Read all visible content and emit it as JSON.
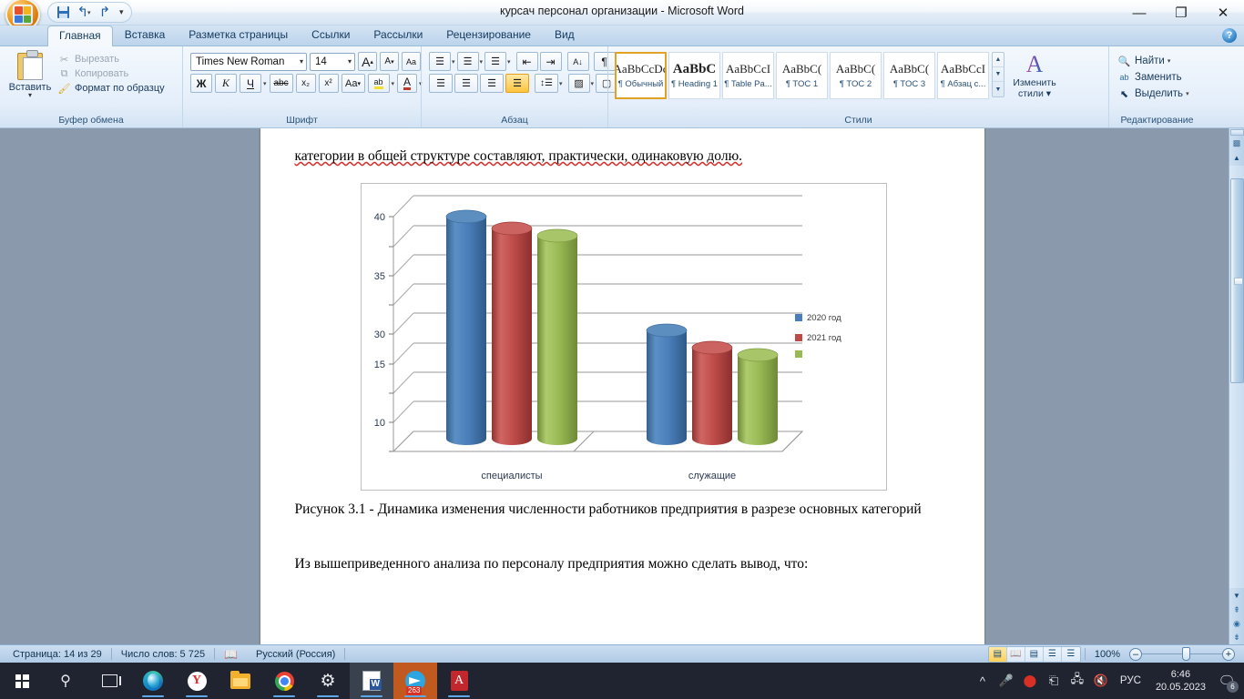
{
  "window": {
    "title": "курсач персонал организации - Microsoft Word",
    "minimize": "—",
    "maximize": "❐",
    "close": "✕",
    "help": "?"
  },
  "quick_access": {
    "save": "save-icon",
    "undo": "↰",
    "undo_caret": "▾",
    "redo": "↱",
    "customize": "▾"
  },
  "ribbon": {
    "tabs": [
      {
        "label": "Главная",
        "active": true
      },
      {
        "label": "Вставка",
        "active": false
      },
      {
        "label": "Разметка страницы",
        "active": false
      },
      {
        "label": "Ссылки",
        "active": false
      },
      {
        "label": "Рассылки",
        "active": false
      },
      {
        "label": "Рецензирование",
        "active": false
      },
      {
        "label": "Вид",
        "active": false
      }
    ],
    "clipboard": {
      "group_label": "Буфер обмена",
      "paste_label": "Вставить",
      "paste_caret": "▾",
      "cut_label": "Вырезать",
      "copy_label": "Копировать",
      "format_painter_label": "Формат по образцу",
      "dialog_launcher": "◹"
    },
    "font": {
      "group_label": "Шрифт",
      "font_name": "Times New Roman",
      "font_size": "14",
      "grow_font": "A",
      "shrink_font": "A",
      "clear_format": "Aa",
      "bold": "Ж",
      "italic": "К",
      "underline": "Ч",
      "underline_caret": "▾",
      "strikethrough": "abc",
      "subscript": "x₂",
      "superscript": "x²",
      "change_case": "Aa",
      "change_case_caret": "▾",
      "highlight": "ab",
      "highlight_caret": "▾",
      "font_color": "A",
      "font_color_caret": "▾",
      "dialog_launcher": "◹"
    },
    "paragraph": {
      "group_label": "Абзац",
      "bullets": "☰",
      "numbering": "☰",
      "multilevel": "☰",
      "decrease_indent": "⇤",
      "increase_indent": "⇥",
      "sort": "A↓",
      "show_marks": "¶",
      "align_left": "☰",
      "align_center": "☰",
      "align_right": "☰",
      "align_justify": "☰",
      "line_spacing": "↕",
      "shading": "▨",
      "borders": "▢",
      "dialog_launcher": "◹"
    },
    "styles": {
      "group_label": "Стили",
      "items": [
        {
          "preview": "AaBbCcDc",
          "name": "¶ Обычный",
          "selected": true,
          "bold": false
        },
        {
          "preview": "AaBbC",
          "name": "¶ Heading 1",
          "selected": false,
          "bold": true
        },
        {
          "preview": "AaBbCcI",
          "name": "¶ Table Pa...",
          "selected": false,
          "bold": false
        },
        {
          "preview": "AaBbC(",
          "name": "¶ TOC 1",
          "selected": false,
          "bold": false
        },
        {
          "preview": "AaBbC(",
          "name": "¶ TOC 2",
          "selected": false,
          "bold": false
        },
        {
          "preview": "AaBbC(",
          "name": "¶ TOC 3",
          "selected": false,
          "bold": false
        },
        {
          "preview": "AaBbCcI",
          "name": "¶ Абзац с...",
          "selected": false,
          "bold": false
        }
      ],
      "scroll_up": "▲",
      "scroll_down": "▼",
      "more": "▼",
      "change_styles_label_line1": "Изменить",
      "change_styles_label_line2": "стили ▾",
      "dialog_launcher": "◹"
    },
    "editing": {
      "group_label": "Редактирование",
      "find": "Найти",
      "find_caret": "▾",
      "replace": "Заменить",
      "select": "Выделить",
      "select_caret": "▾"
    }
  },
  "document": {
    "paragraph_top": "категории в общей структуре составляют, практически, одинаковую долю.",
    "caption": "Рисунок 3.1 - Динамика изменения численности работников предприятия в разрезе основных категорий",
    "paragraph_bottom": "Из вышеприведенного анализа по персоналу предприятия можно сделать вывод, что:"
  },
  "chart_data": {
    "type": "bar",
    "title": "",
    "xlabel": "",
    "ylabel": "",
    "categories": [
      "специалисты",
      "служащие"
    ],
    "series": [
      {
        "name": "2020 год",
        "color": "#4a7ebb",
        "values": [
          41.5,
          31.5
        ]
      },
      {
        "name": "2021 год",
        "color": "#be4b48",
        "values": [
          40.3,
          30.3
        ]
      },
      {
        "name": "",
        "color": "#98b954",
        "values": [
          39.5,
          29.7
        ]
      }
    ],
    "y_tick_labels": [
      "40",
      "35",
      "30",
      "15",
      "10"
    ],
    "y_tick_positions": [
      41.0,
      35.0,
      30.0,
      26.5,
      15.0
    ],
    "grid": true,
    "legend_position": "right",
    "style": "3d-cylinder"
  },
  "statusbar": {
    "page": "Страница: 14 из 29",
    "words": "Число слов: 5 725",
    "proofing_icon": "spellcheck-icon",
    "language": "Русский (Россия)",
    "views": [
      {
        "icon": "print-layout-icon",
        "selected": true
      },
      {
        "icon": "full-screen-reading-icon",
        "selected": false
      },
      {
        "icon": "web-layout-icon",
        "selected": false
      },
      {
        "icon": "outline-icon",
        "selected": false
      },
      {
        "icon": "draft-icon",
        "selected": false
      }
    ],
    "zoom": "100%",
    "zoom_out": "–",
    "zoom_in": "+"
  },
  "scrollbar": {
    "up": "▲",
    "down": "▼",
    "prev_page": "⇞",
    "select_object": "◉",
    "next_page": "⇟",
    "split": "split-handle",
    "object_browser": "select-browse-object-icon"
  },
  "taskbar": {
    "items": [
      {
        "name": "start-button",
        "icon": "windows-logo-icon",
        "active": false,
        "running": false
      },
      {
        "name": "search-button",
        "icon": "search-icon",
        "active": false,
        "running": false
      },
      {
        "name": "task-view-button",
        "icon": "task-view-icon",
        "active": false,
        "running": false
      },
      {
        "name": "edge",
        "icon": "edge-icon",
        "active": false,
        "running": true
      },
      {
        "name": "yandex-browser",
        "icon": "yandex-icon",
        "active": false,
        "running": true
      },
      {
        "name": "file-explorer",
        "icon": "folder-icon",
        "active": false,
        "running": false
      },
      {
        "name": "chrome",
        "icon": "chrome-icon",
        "active": false,
        "running": true
      },
      {
        "name": "settings",
        "icon": "gear-icon",
        "active": false,
        "running": true
      },
      {
        "name": "word",
        "icon": "word-icon",
        "active": true,
        "running": true
      },
      {
        "name": "telegram",
        "icon": "telegram-icon",
        "active": false,
        "running": true,
        "badge": "263"
      },
      {
        "name": "acrobat-reader",
        "icon": "pdf-icon",
        "active": false,
        "running": true
      }
    ],
    "tray": {
      "show_hidden": "^",
      "microphone": "mic-icon",
      "alert": "alert-icon",
      "usb": "usb-icon",
      "network": "network-icon",
      "volume": "volume-muted-icon",
      "language": "РУС",
      "time": "6:46",
      "date": "20.05.2023",
      "notifications": "notification-icon",
      "notification_count": "6"
    }
  }
}
